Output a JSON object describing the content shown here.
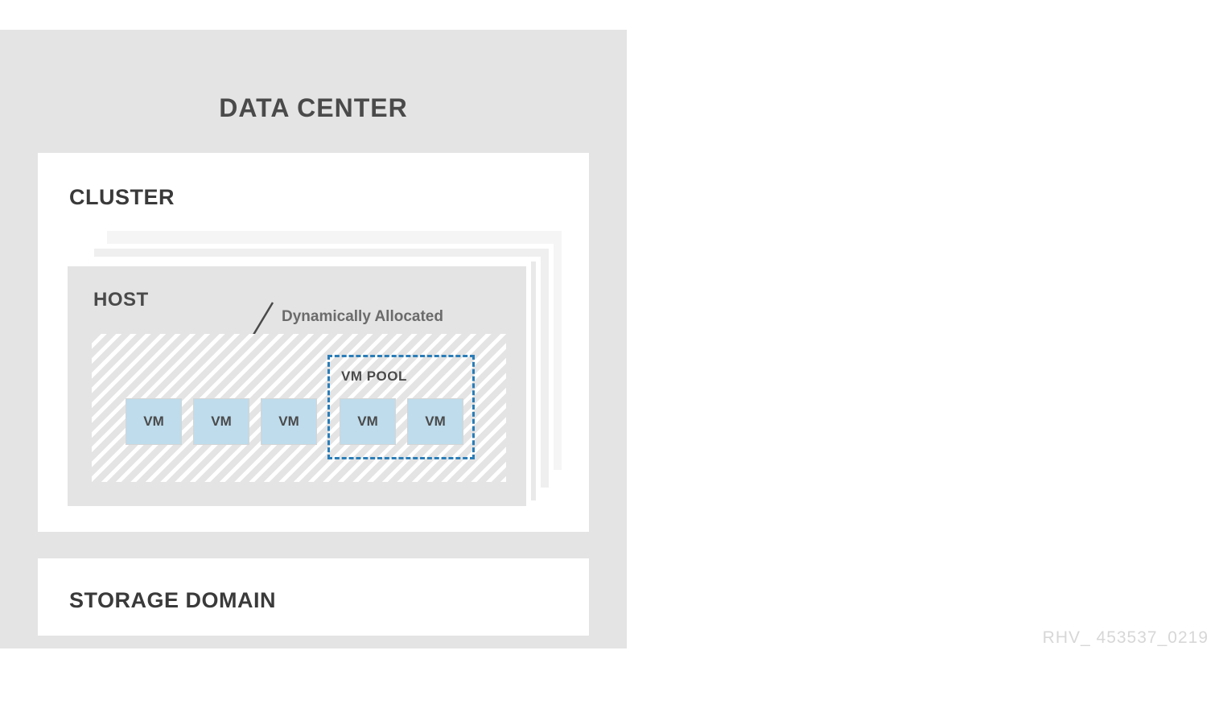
{
  "diagram": {
    "datacenter_title": "DATA CENTER",
    "cluster_title": "CLUSTER",
    "host_title": "HOST",
    "dynamic_label": "Dynamically Allocated",
    "vm_pool_label": "VM POOL",
    "vms": [
      "VM",
      "VM",
      "VM",
      "VM",
      "VM"
    ],
    "storage_title": "STORAGE DOMAIN",
    "footer_id": "RHV_ 453537_0219"
  }
}
